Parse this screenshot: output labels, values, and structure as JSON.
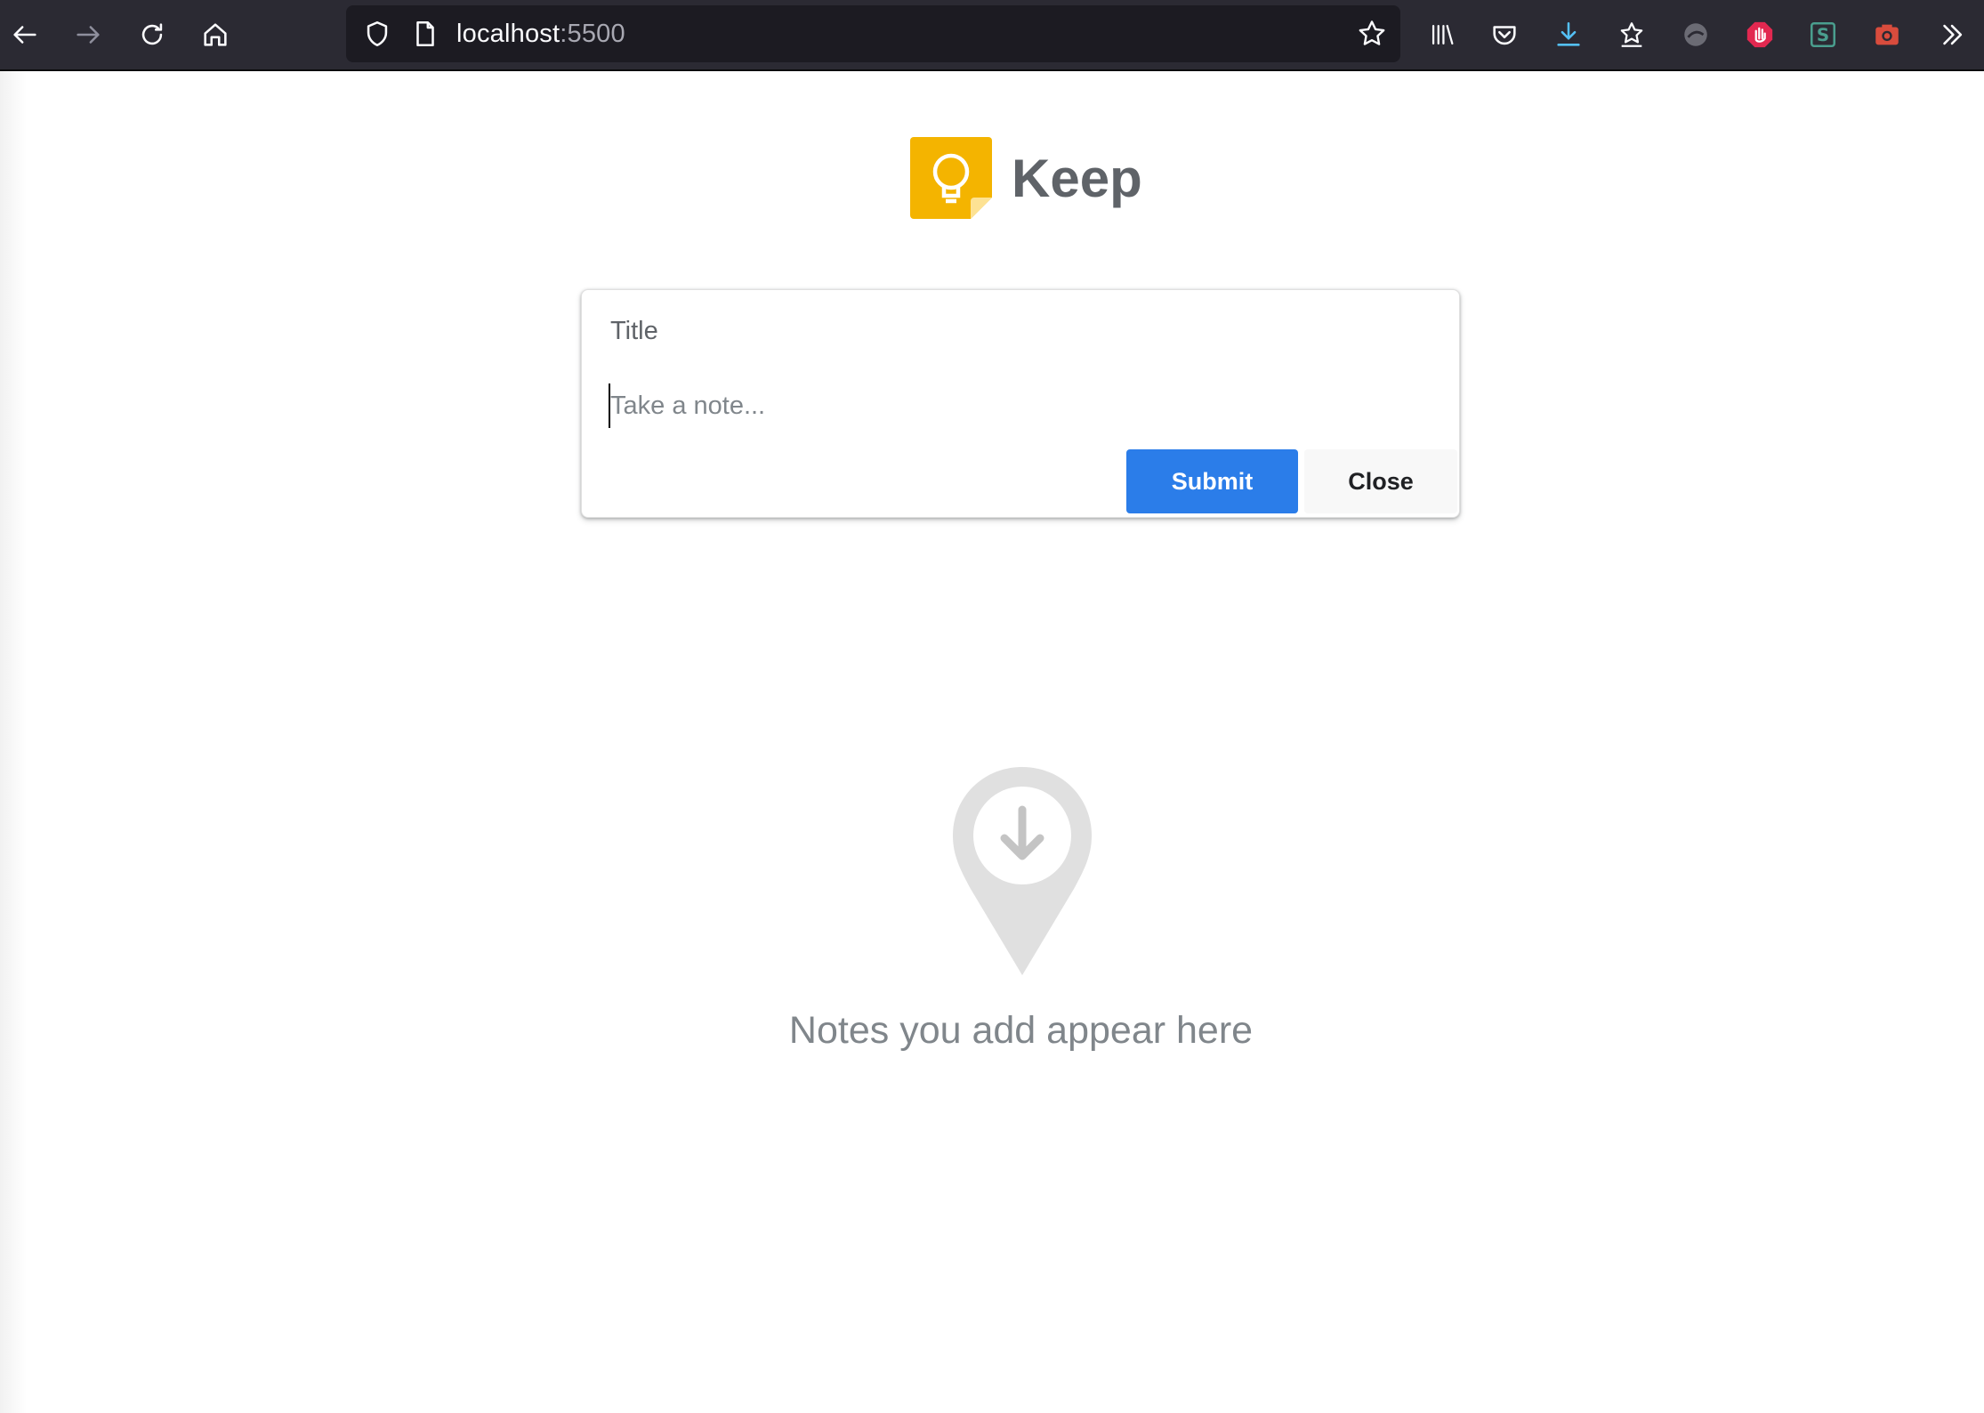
{
  "browser": {
    "url_host": "localhost",
    "url_port": ":5500"
  },
  "app": {
    "title": "Keep"
  },
  "note_form": {
    "title_placeholder": "Title",
    "title_value": "",
    "note_placeholder": "Take a note...",
    "note_value": "",
    "submit_label": "Submit",
    "close_label": "Close"
  },
  "empty_state": {
    "message": "Notes you add appear here"
  },
  "colors": {
    "toolbar_bg": "#2b2a33",
    "urlbar_bg": "#1c1b22",
    "submit_bg": "#2b7de9",
    "logo_yellow": "#f4b400"
  }
}
